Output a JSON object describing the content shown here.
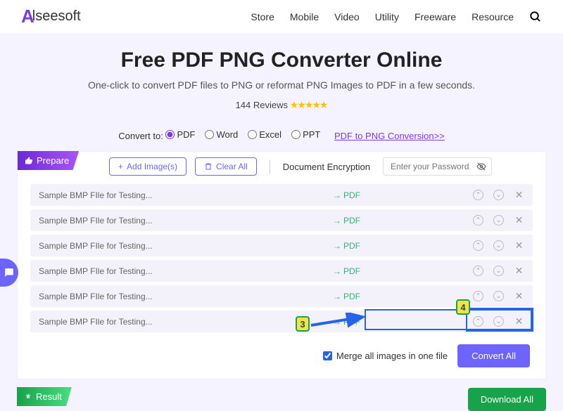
{
  "logo": {
    "prefix": "A",
    "rest": "lseesoft"
  },
  "nav": [
    "Store",
    "Mobile",
    "Video",
    "Utility",
    "Freeware",
    "Resource"
  ],
  "hero": {
    "title": "Free PDF PNG Converter Online",
    "subtitle": "One-click to convert PDF files to PNG or reformat PNG Images to PDF in a few seconds.",
    "reviews_count": "144 Reviews"
  },
  "convert_to": {
    "label": "Convert to:",
    "options": [
      "PDF",
      "Word",
      "Excel",
      "PPT"
    ],
    "selected": "PDF",
    "link": "PDF to PNG Conversion>>"
  },
  "prepare": {
    "tab": "Prepare",
    "add": "Add Image(s)",
    "clear": "Clear All",
    "encryption_label": "Document Encryption",
    "encryption_placeholder": "Enter your Password."
  },
  "files": [
    {
      "name": "Sample BMP FIle for Testing...",
      "fmt": "PDF"
    },
    {
      "name": "Sample BMP FIle for Testing...",
      "fmt": "PDF"
    },
    {
      "name": "Sample BMP FIle for Testing...",
      "fmt": "PDF"
    },
    {
      "name": "Sample BMP FIle for Testing...",
      "fmt": "PDF"
    },
    {
      "name": "Sample BMP FIle for Testing...",
      "fmt": "PDF"
    },
    {
      "name": "Sample BMP FIle for Testing...",
      "fmt": "PDF"
    }
  ],
  "merge": {
    "label": "Merge all images in one file",
    "checked": true
  },
  "convert_all": "Convert All",
  "result": {
    "tab": "Result",
    "download": "Download All"
  },
  "annotations": {
    "step3": "3",
    "step4": "4"
  }
}
